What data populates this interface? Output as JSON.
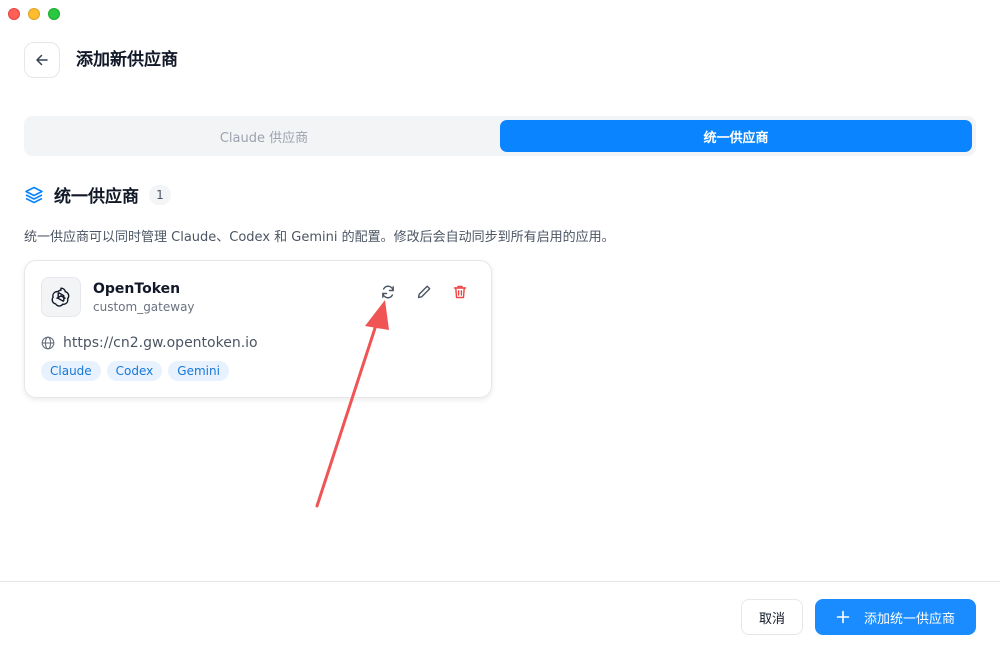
{
  "header": {
    "title": "添加新供应商",
    "back_icon": "arrow-left-icon"
  },
  "tabs": [
    {
      "label": "Claude 供应商",
      "active": false
    },
    {
      "label": "统一供应商",
      "active": true
    }
  ],
  "section": {
    "title": "统一供应商",
    "count": "1",
    "icon": "layers-icon",
    "description": "统一供应商可以同时管理 Claude、Codex 和 Gemini 的配置。修改后会自动同步到所有启用的应用。"
  },
  "provider": {
    "name": "OpenToken",
    "type": "custom_gateway",
    "url": "https://cn2.gw.opentoken.io",
    "logo_icon": "openai-logo-icon",
    "tags": [
      "Claude",
      "Codex",
      "Gemini"
    ],
    "actions": [
      "sync-icon",
      "edit-icon",
      "delete-icon"
    ]
  },
  "footer": {
    "cancel_label": "取消",
    "primary_label": "添加统一供应商"
  },
  "colors": {
    "accent": "#0a84ff",
    "danger": "#ef4444",
    "annotation": "#f05454"
  }
}
